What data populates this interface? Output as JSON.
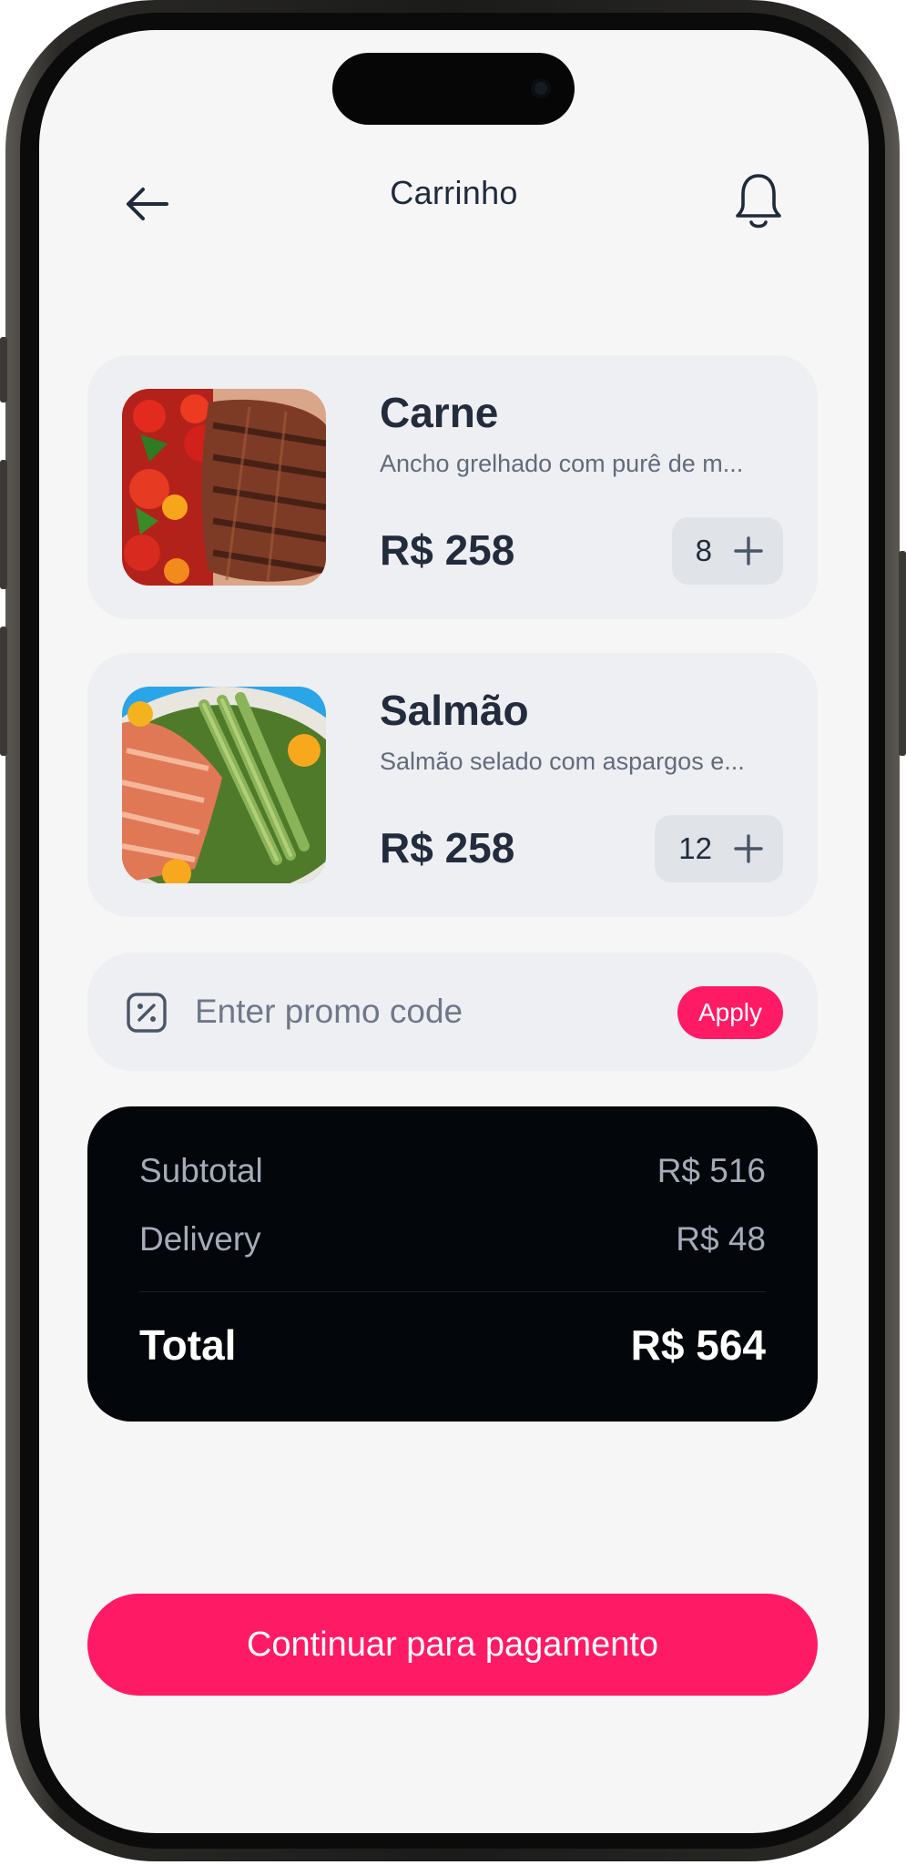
{
  "header": {
    "title": "Carrinho",
    "back_icon": "arrow-left-icon",
    "notification_icon": "bell-icon"
  },
  "cart": {
    "items": [
      {
        "name": "Carne",
        "description": "Ancho grelhado com purê de m...",
        "price": "R$ 258",
        "quantity": "8",
        "image": "grilled-steak-with-tomatoes"
      },
      {
        "name": "Salmão",
        "description": "Salmão selado com aspargos e...",
        "price": "R$ 258",
        "quantity": "12",
        "image": "seared-salmon-with-asparagus"
      }
    ]
  },
  "promo": {
    "icon": "discount-icon",
    "placeholder": "Enter promo code",
    "value": "",
    "apply_label": "Apply"
  },
  "summary": {
    "subtotal_label": "Subtotal",
    "subtotal_value": "R$ 516",
    "delivery_label": "Delivery",
    "delivery_value": "R$ 48",
    "total_label": "Total",
    "total_value": "R$ 564"
  },
  "cta": {
    "label": "Continuar para pagamento"
  },
  "colors": {
    "accent": "#ff1a66",
    "text_primary": "#222c3d",
    "card_bg": "#eeeff2",
    "summary_bg": "#03060b",
    "screen_bg": "#f6f6f7"
  }
}
